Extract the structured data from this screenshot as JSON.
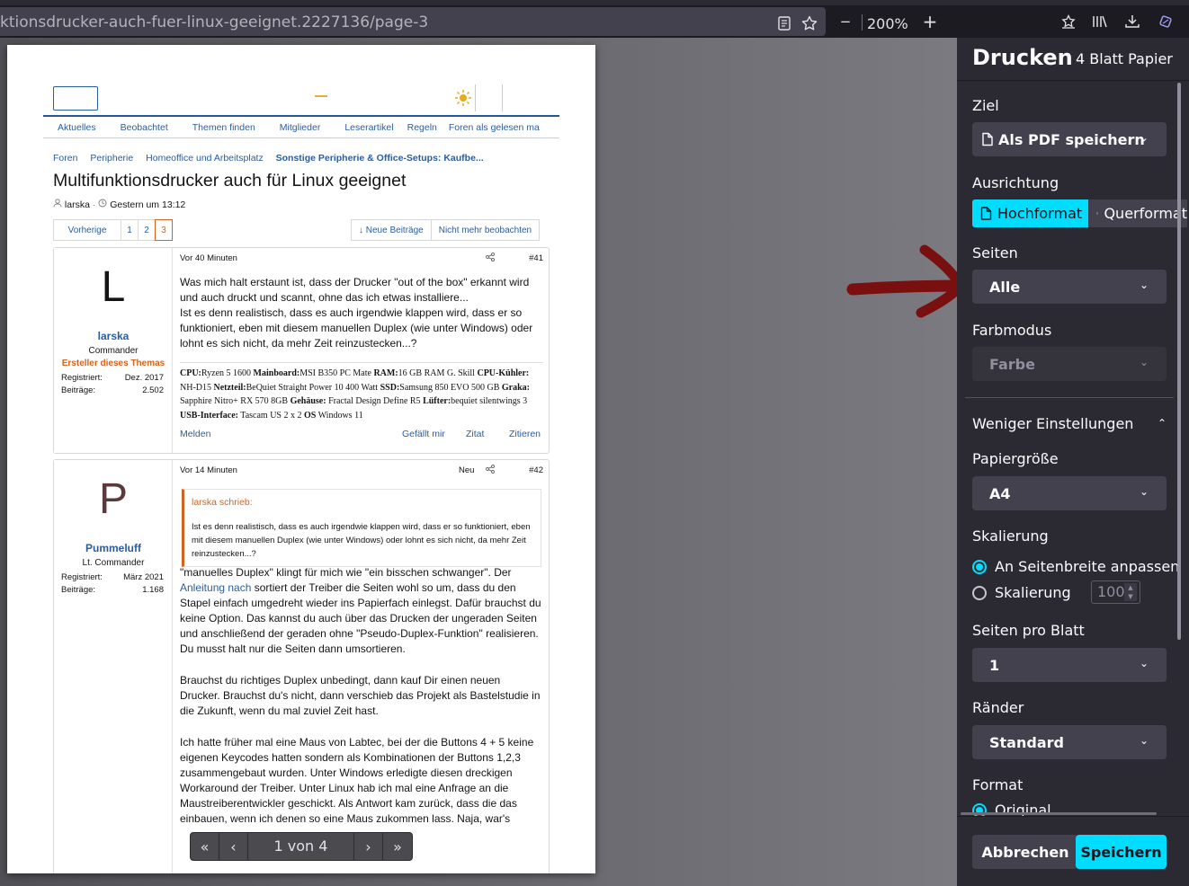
{
  "toolbar": {
    "url": "ktionsdrucker-auch-fuer-linux-geeignet.2227136/page-3",
    "zoom": "200%",
    "zoom_out": "−",
    "zoom_in": "+"
  },
  "page": {
    "nav": [
      "Aktuelles",
      "Beobachtet",
      "Themen finden",
      "Mitglieder",
      "Leserartikel",
      "Regeln",
      "Foren als gelesen ma"
    ],
    "breadcrumb": [
      "Foren",
      "Peripherie",
      "Homeoffice und Arbeitsplatz",
      "Sonstige Peripherie & Office-Setups: Kaufbe..."
    ],
    "thread_title": "Multifunktionsdrucker auch für Linux geeignet",
    "thread_author": "larska",
    "thread_time": "Gestern um 13:12",
    "pager": {
      "prev": "Vorherige",
      "pages": [
        "1",
        "2",
        "3"
      ]
    },
    "thread_actions": [
      "↓ Neue Beiträge",
      "Nicht mehr beobachten"
    ],
    "posts": [
      {
        "avatar": "L",
        "user": "larska",
        "rank": "Commander",
        "starter": "Ersteller dieses Themas",
        "reg_label": "Registriert:",
        "reg_value": "Dez. 2017",
        "posts_label": "Beiträge:",
        "posts_value": "2.502",
        "time": "Vor 40 Minuten",
        "number": "#41",
        "text1": "Was mich halt erstaunt ist, dass der Drucker \"out of the box\" erkannt wird und auch druckt und scannt, ohne das ich etwas installiere...",
        "text2": "Ist es denn realistisch, dass es auch irgendwie klappen wird, dass er so funktioniert, eben mit diesem manuellen Duplex (wie unter Windows) oder lohnt es sich nicht, da mehr Zeit reinzustecken...?",
        "sig": [
          {
            "k": "CPU:",
            "v": "Ryzen 5 1600 "
          },
          {
            "k": "Mainboard:",
            "v": "MSI B350 PC Mate "
          },
          {
            "k": "RAM:",
            "v": "16 GB RAM G. Skill "
          },
          {
            "k": "CPU-Kühler:",
            "v": " NH-D15 "
          },
          {
            "k": "Netzteil:",
            "v": "BeQuiet Straight Power 10 400 Watt "
          },
          {
            "k": "SSD:",
            "v": "Samsung 850 EVO 500 GB "
          },
          {
            "k": "Graka:",
            "v": " Sapphire Nitro+ RX 570 8GB "
          },
          {
            "k": "Gehäuse:",
            "v": " Fractal Design Define R5 "
          },
          {
            "k": "Lüfter:",
            "v": "bequiet silentwings 3 "
          },
          {
            "k": "USB-Interface:",
            "v": " Tascam US 2 x 2 "
          },
          {
            "k": "OS",
            "v": " Windows 11"
          }
        ],
        "report": "Melden",
        "like": "Gefällt mir",
        "quote": "Zitat",
        "reply": "Zitieren"
      },
      {
        "avatar": "P",
        "user": "Pummeluff",
        "rank": "Lt. Commander",
        "reg_label": "Registriert:",
        "reg_value": "März 2021",
        "posts_label": "Beiträge:",
        "posts_value": "1.168",
        "time": "Vor 14 Minuten",
        "new": "Neu",
        "number": "#42",
        "quote_author": "larska schrieb:",
        "quote_text": "Ist es denn realistisch, dass es auch irgendwie klappen wird, dass er so funktioniert, eben mit diesem manuellen Duplex (wie unter Windows) oder lohnt es sich nicht, da mehr Zeit reinzustecken...?",
        "p1_a": "\"manuelles Duplex\" klingt für mich wie \"ein bisschen schwanger\". Der ",
        "p1_link": "Anleitung nach",
        "p1_b": " sortiert der Treiber die Seiten wohl so um, dass du den Stapel einfach umgedreht wieder ins Papierfach einlegst. Dafür brauchst du keine Option. Das kannst du auch über das Drucken der ungeraden Seiten und anschließend der geraden ohne \"Pseudo-Duplex-Funktion\" realisieren. Du musst halt nur die Seiten dann umsortieren.",
        "p2": "Brauchst du richtiges Duplex unbedingt, dann kauf Dir einen neuen Drucker. Brauchst du's nicht, dann verschieb das Projekt als Bastelstudie in die Zukunft, wenn du mal zuviel Zeit hast.",
        "p3": "Ich hatte früher mal eine Maus von Labtec, bei der die Buttons 4 + 5 keine eigenen Keycodes hatten sondern als Kombinationen der Buttons 1,2,3 zusammengebaut wurden. Unter Windows erledigte diesen dreckigen Workaround der Treiber. Unter Linux hab ich mal eine Anfrage an die Maustreiberentwickler geschickt. Als Antwort kam zurück, dass die das einbauen, wenn ich denen so eine Maus zukommen lass. Naja, war's"
      }
    ]
  },
  "page_nav": {
    "label": "1 von 4",
    "first": "«",
    "prev": "‹",
    "next": "›",
    "last": "»"
  },
  "print": {
    "title": "Drucken",
    "sheets": "4 Blatt Papier",
    "destination_label": "Ziel",
    "destination_value": "Als PDF speichern",
    "orientation_label": "Ausrichtung",
    "orientation_portrait": "Hochformat",
    "orientation_landscape": "Querformat",
    "pages_label": "Seiten",
    "pages_value": "Alle",
    "color_label": "Farbmodus",
    "color_value": "Farbe",
    "more_settings": "Weniger Einstellungen",
    "paper_label": "Papiergröße",
    "paper_value": "A4",
    "scale_label": "Skalierung",
    "scale_fit": "An Seitenbreite anpassen",
    "scale_custom": "Skalierung",
    "scale_value": "100",
    "per_sheet_label": "Seiten pro Blatt",
    "per_sheet_value": "1",
    "margins_label": "Ränder",
    "margins_value": "Standard",
    "format_label": "Format",
    "format_original": "Original",
    "cancel": "Abbrechen",
    "save": "Speichern"
  },
  "colors": {
    "accent": "#00ddff",
    "panel_bg": "#2b2a33",
    "link": "#2b5da0",
    "orange": "#d4631f",
    "arrow": "#7a0f0f"
  }
}
